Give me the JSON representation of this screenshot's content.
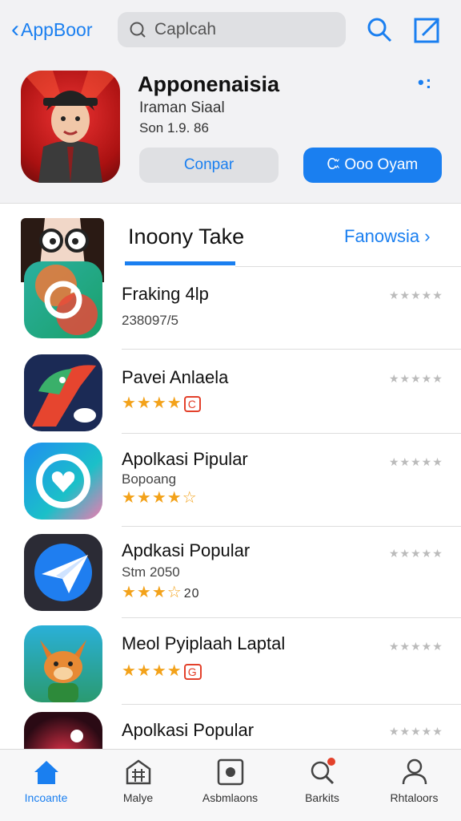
{
  "topbar": {
    "back_label": "AppBoor",
    "search_placeholder": "Caplcah",
    "icons": [
      "chevron-left-icon",
      "search-icon",
      "search-icon",
      "compose-icon"
    ]
  },
  "app": {
    "title": "Apponenaisia",
    "subtitle": "Iraman Siaal",
    "version": "Son 1.9. 86",
    "more_label": "•:",
    "secondary_button": "Conpar",
    "primary_button": "Ꮸ Ooo Oyam"
  },
  "section": {
    "title": "Inoony Take",
    "link": "Fanowsia",
    "link_chevron": "›"
  },
  "rows": [
    {
      "name": "Fraking 4lp",
      "meta": "238097/5",
      "stars": "",
      "badge": "",
      "extra": "",
      "rank": "★★★★★"
    },
    {
      "name": "Pavei Anlaela",
      "meta": "",
      "stars": "★★★★",
      "badge": "C",
      "extra": "",
      "rank": "★★★★★"
    },
    {
      "name": "Apolkasi Pipular",
      "meta": "Bopoang",
      "stars": "★★★★☆",
      "badge": "",
      "extra": "",
      "rank": "★★★★★"
    },
    {
      "name": "Apdkasi Popular",
      "meta": "Stm 2050",
      "stars": "★★★☆",
      "badge": "",
      "extra": "20",
      "rank": "★★★★★"
    },
    {
      "name": "Meol Pyiplaah Laptal",
      "meta": "",
      "stars": "★★★★",
      "badge": "G",
      "extra": "",
      "rank": "★★★★★"
    },
    {
      "name": "Apolkasi Popular",
      "meta": "",
      "stars": "",
      "badge": "",
      "extra": "",
      "rank": "★★★★★"
    }
  ],
  "tabs": [
    {
      "label": "Incoante",
      "icon": "home-icon",
      "active": true
    },
    {
      "label": "Malye",
      "icon": "grid-icon",
      "active": false
    },
    {
      "label": "Asbmlaons",
      "icon": "apps-icon",
      "active": false
    },
    {
      "label": "Barkits",
      "icon": "search-icon",
      "active": false
    },
    {
      "label": "Rhtaloors",
      "icon": "person-icon",
      "active": false
    }
  ],
  "colors": {
    "accent": "#1a7ff0",
    "star": "#f3a21a",
    "badge": "#e3412b",
    "background": "#f2f2f4"
  }
}
